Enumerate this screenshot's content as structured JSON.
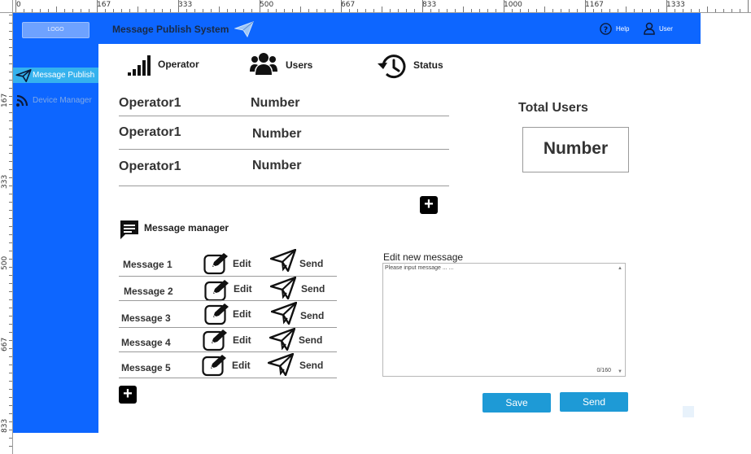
{
  "ruler": {
    "top_labels": [
      "0",
      "167",
      "333",
      "500",
      "667",
      "833",
      "1000",
      "1167",
      "1333"
    ],
    "left_labels": [
      "167",
      "333",
      "500",
      "667",
      "833"
    ]
  },
  "sidebar": {
    "logo_label": "LOGO",
    "items": [
      {
        "label": "Message Publish",
        "icon": "paper-plane-icon",
        "active": true
      },
      {
        "label": "Device Manager",
        "icon": "rss-feed-icon",
        "active": false
      }
    ]
  },
  "header": {
    "title": "Message Publish System",
    "help_label": "Help",
    "user_label": "User"
  },
  "tabs": [
    {
      "label": "Operator",
      "icon": "signal-bars-icon"
    },
    {
      "label": "Users",
      "icon": "users-group-icon"
    },
    {
      "label": "Status",
      "icon": "history-clock-icon"
    }
  ],
  "operators": [
    {
      "name": "Operator1",
      "value": "Number"
    },
    {
      "name": "Operator1",
      "value": "Number"
    },
    {
      "name": "Operator1",
      "value": "Number"
    }
  ],
  "total_users": {
    "title": "Total Users",
    "value": "Number"
  },
  "message_manager": {
    "title": "Message manager",
    "edit_label": "Edit",
    "send_label": "Send",
    "messages": [
      "Message 1",
      "Message 2",
      "Message 3",
      "Message 4",
      "Message 5"
    ]
  },
  "editor": {
    "title": "Edit new message",
    "placeholder": "Please input message ... ...",
    "counter": "0/160",
    "save_label": "Save",
    "send_label": "Send"
  },
  "colors": {
    "brand_blue": "#0d66ff",
    "active_nav": "#35b2ee",
    "button_blue": "#1e9ad6"
  }
}
